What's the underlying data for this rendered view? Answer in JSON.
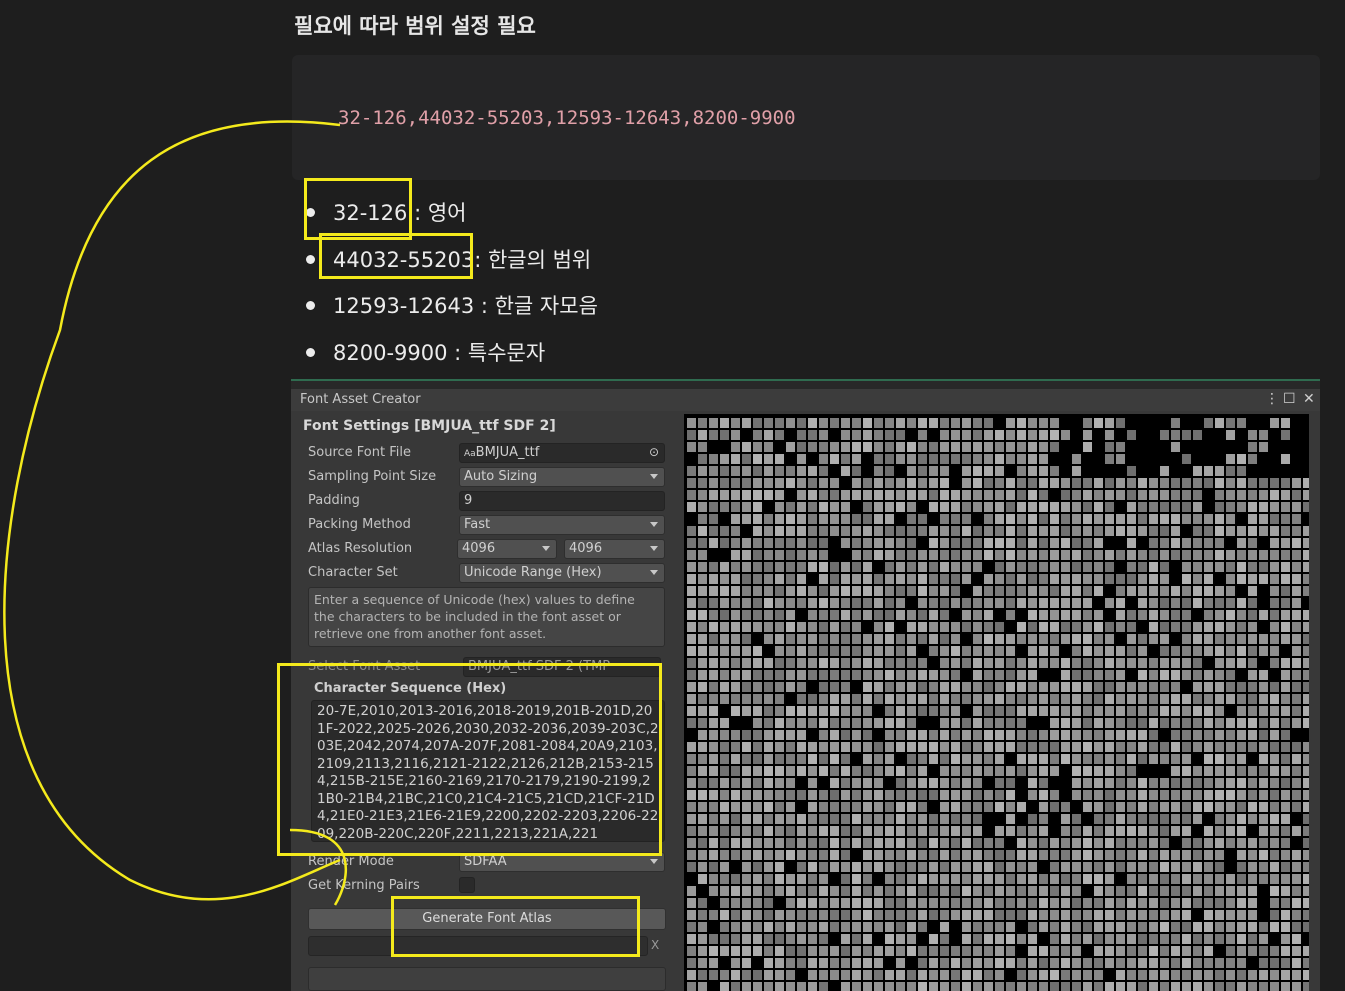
{
  "doc": {
    "heading": "필요에 따라 범위 설정 필요",
    "code": "32-126,44032-55203,12593-12643,8200-9900",
    "bullets": [
      {
        "range": "32-126",
        "desc": " : 영어"
      },
      {
        "range": "44032-55203",
        "desc": ": 한글의 범위"
      },
      {
        "range": "12593-12643",
        "desc": " : 한글 자모음"
      },
      {
        "range": "8200-9900",
        "desc": " : 특수문자"
      }
    ]
  },
  "window": {
    "title": "Font Asset Creator",
    "settings_title": "Font Settings [BMJUA_ttf SDF 2]",
    "rows": {
      "source_font_label": "Source Font File",
      "source_font_value": "BMJUA_ttf",
      "source_font_badge": "Aa",
      "sampling_label": "Sampling Point Size",
      "sampling_value": "Auto Sizing",
      "padding_label": "Padding",
      "padding_value": "9",
      "packing_label": "Packing Method",
      "packing_value": "Fast",
      "atlas_label": "Atlas Resolution",
      "atlas_w": "4096",
      "atlas_h": "4096",
      "charset_label": "Character Set",
      "charset_value": "Unicode Range (Hex)",
      "help_text": "Enter a sequence of Unicode (hex) values to define the characters to be included in the font asset or retrieve one from another font asset.",
      "select_asset_label": "Select Font Asset",
      "select_asset_value": "BMJUA_ttf SDF 2 (TMP",
      "sequence_label": "Character Sequence (Hex)",
      "sequence_value": "20-7E,2010,2013-2016,2018-2019,201B-201D,201F-2022,2025-2026,2030,2032-2036,2039-203C,203E,2042,2074,207A-207F,2081-2084,20A9,2103,2109,2113,2116,2121-2122,2126,212B,2153-2154,215B-215E,2160-2169,2170-2179,2190-2199,21B0-21B4,21BC,21C0,21C4-21C5,21CD,21CF-21D4,21E0-21E3,21E6-21E9,2200,2202-2203,2206-2209,220B-220C,220F,2211,2213,221A,221",
      "render_label": "Render Mode",
      "render_value": "SDFAA",
      "kerning_label": "Get Kerning Pairs",
      "generate_label": "Generate Font Atlas",
      "progress_close": "X"
    },
    "controls": {
      "menu": "⋮",
      "maximize": "☐",
      "close": "✕"
    }
  },
  "colors": {
    "highlight": "#f4ea1c",
    "code_text": "#e0a0a8",
    "background": "#1e1e1e"
  }
}
